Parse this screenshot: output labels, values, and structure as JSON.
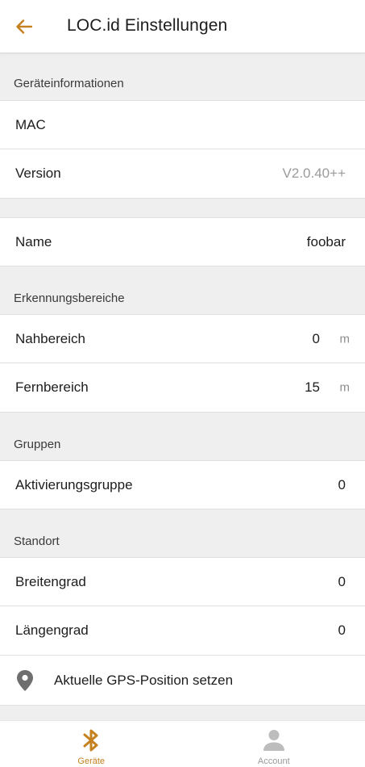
{
  "colors": {
    "accent": "#c5811f",
    "background": "#efefef",
    "row_bg": "#ffffff",
    "muted_text": "#9b9b9b"
  },
  "header": {
    "back_icon": "arrow-left-icon",
    "title": "LOC.id Einstellungen"
  },
  "device_info": {
    "section_title": "Geräteinformationen",
    "mac_label": "MAC",
    "mac_value": "",
    "version_label": "Version",
    "version_value": "V2.0.40++"
  },
  "name": {
    "label": "Name",
    "value": "foobar"
  },
  "detection": {
    "section_title": "Erkennungsbereiche",
    "near_label": "Nahbereich",
    "near_value": "0",
    "near_unit": "m",
    "far_label": "Fernbereich",
    "far_value": "15",
    "far_unit": "m"
  },
  "groups": {
    "section_title": "Gruppen",
    "activation_label": "Aktivierungsgruppe",
    "activation_value": "0"
  },
  "location": {
    "section_title": "Standort",
    "latitude_label": "Breitengrad",
    "latitude_value": "0",
    "longitude_label": "Längengrad",
    "longitude_value": "0",
    "gps_icon": "map-pin-icon",
    "gps_label": "Aktuelle GPS-Position setzen"
  },
  "bottom_nav": {
    "items": [
      {
        "label": "Geräte",
        "icon": "bluetooth-icon",
        "active": true
      },
      {
        "label": "Account",
        "icon": "user-icon",
        "active": false
      }
    ]
  }
}
